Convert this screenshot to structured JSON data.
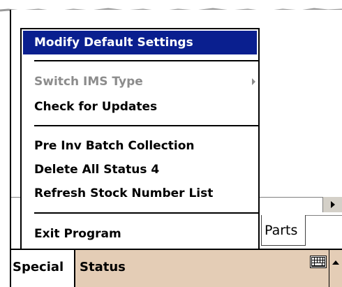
{
  "menu": {
    "items": {
      "modify_default_settings": "Modify Default Settings",
      "switch_ims_type": "Switch IMS Type",
      "check_for_updates": "Check for Updates",
      "pre_inv_batch_collection": "Pre Inv Batch Collection",
      "delete_all_status_4": "Delete All Status 4",
      "refresh_stock_number_list": "Refresh Stock Number List",
      "exit_program": "Exit Program"
    },
    "selected_color": "#0a1f8f",
    "disabled_color": "#8c8c8c"
  },
  "tabs": {
    "parts_label": "Parts"
  },
  "command_bar": {
    "special_label": "Special",
    "status_label": "Status",
    "background": "#e4cdb6",
    "keyboard_icon": "keyboard-icon",
    "sip_arrow_icon": "sip-up-arrow-icon"
  },
  "scrollbar": {
    "right_arrow_icon": "scroll-right-arrow-icon"
  }
}
